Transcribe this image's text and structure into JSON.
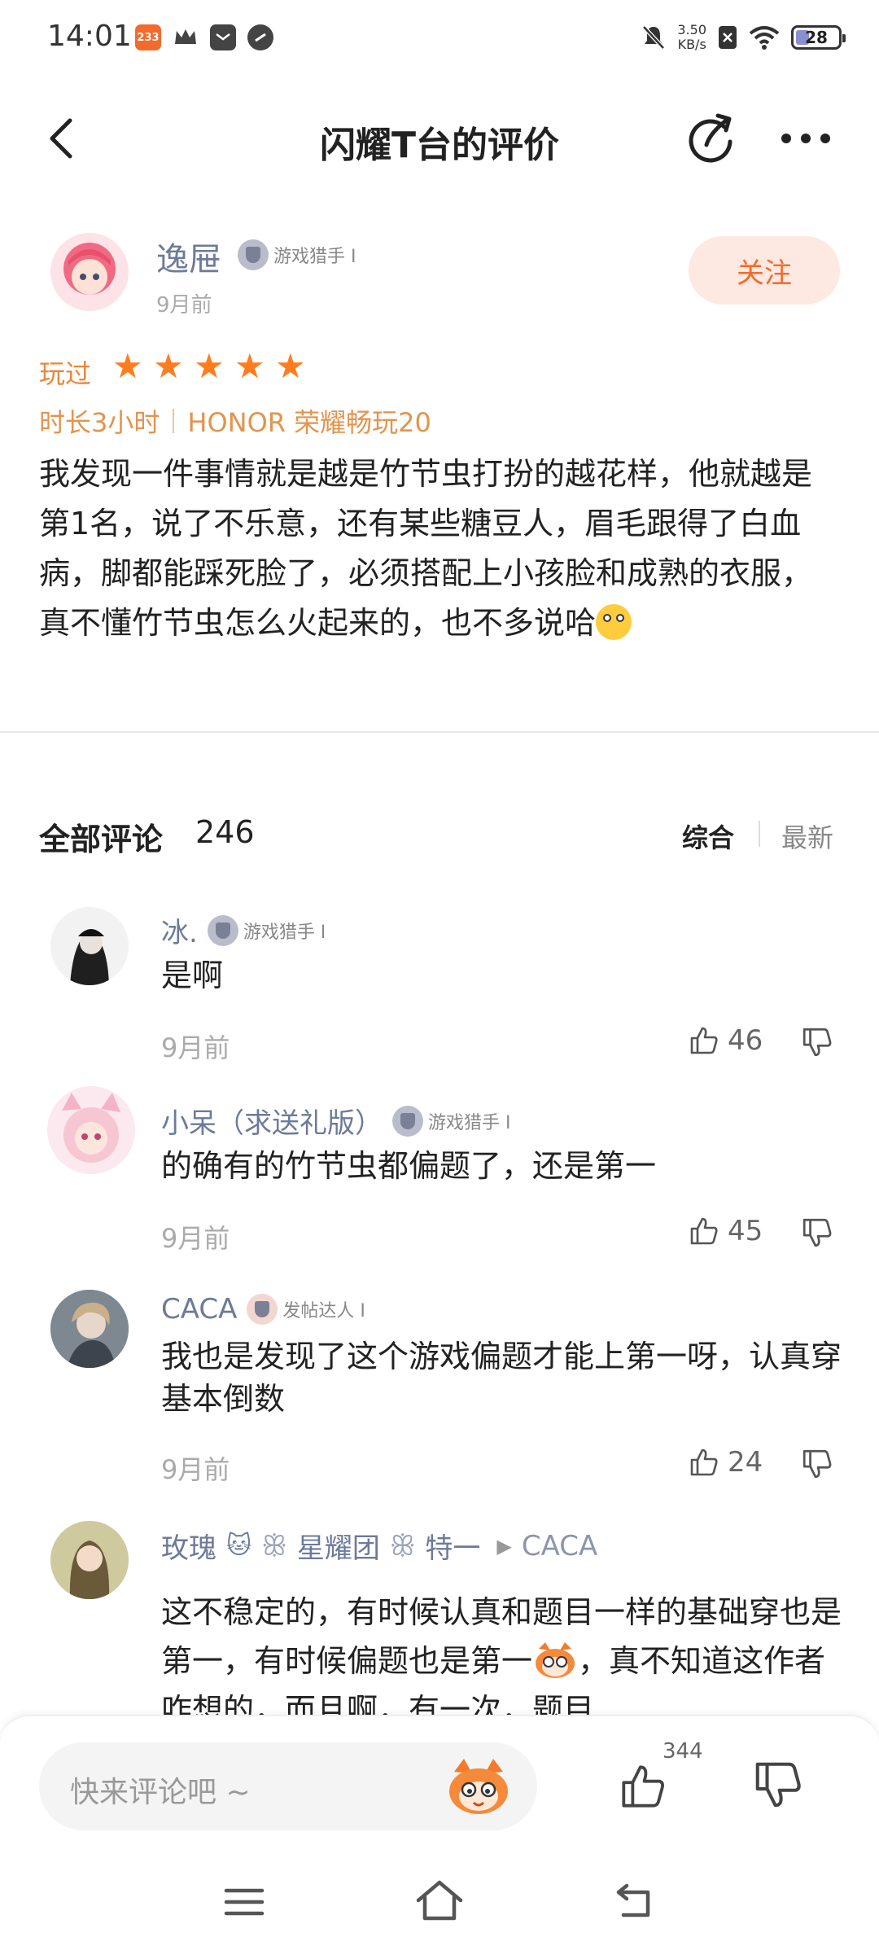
{
  "status": {
    "time": "14:01",
    "notif_badge": "233",
    "net_speed_value": "3.50",
    "net_speed_unit": "KB/s",
    "battery": "28"
  },
  "nav": {
    "title": "闪耀T台的评价"
  },
  "review": {
    "author": "逸屉",
    "badge": "游戏猎手 I",
    "time": "9月前",
    "follow": "关注",
    "played": "玩过",
    "rating": 5,
    "duration": "时长3小时",
    "device": "HONOR 荣耀畅玩20",
    "text": "我发现一件事情就是越是竹节虫打扮的越花样，他就越是第1名，说了不乐意，还有某些糖豆人，眉毛跟得了白血病，脚都能踩死脸了，必须搭配上小孩脸和成熟的衣服，真不懂竹节虫怎么火起来的，也不多说哈"
  },
  "comments_header": {
    "title": "全部评论",
    "count": "246",
    "sort_comprehensive": "综合",
    "sort_latest": "最新"
  },
  "comments": [
    {
      "name": "冰.",
      "badge": "游戏猎手 I",
      "text": "是啊",
      "time": "9月前",
      "likes": "46"
    },
    {
      "name": "小呆（求送礼版）",
      "badge": "游戏猎手 I",
      "text": "的确有的竹节虫都偏题了，还是第一",
      "time": "9月前",
      "likes": "45"
    },
    {
      "name": "CACA",
      "badge": "发帖达人 I",
      "text": "我也是发现了这个游戏偏题才能上第一呀，认真穿基本倒数",
      "time": "9月前",
      "likes": "24"
    },
    {
      "name": "玫瑰",
      "name_mid": "星耀团",
      "name_end": "特一",
      "reply_to": "CACA",
      "text_a": "这不稳定的，有时候认真和题目一样的基础穿也是第一，有时候偏题也是第一",
      "text_b": "，真不知道这作者咋想的，而且啊，有一次，题目"
    }
  ],
  "bottom": {
    "placeholder": "快来评论吧 ~",
    "likes": "344"
  }
}
